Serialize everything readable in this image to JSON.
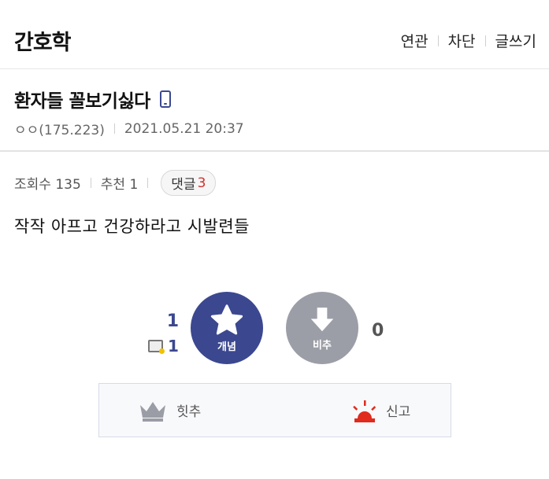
{
  "header": {
    "gallery_title": "간호학",
    "menu": [
      "연관",
      "차단",
      "글쓰기"
    ]
  },
  "post": {
    "title": "환자들 꼴보기싫다",
    "author": "ㅇㅇ(175.223)",
    "date": "2021.05.21 20:37",
    "views_label": "조회수 135",
    "recommend_label": "추천 1",
    "comments_label": "댓글",
    "comments_count": "3",
    "body": "작작 아프고 건강하라고 시발련들"
  },
  "votes": {
    "up_count": "1",
    "fixed_up_count": "1",
    "up_label": "개념",
    "down_label": "비추",
    "down_count": "0"
  },
  "actions": {
    "hit_label": "힛추",
    "report_label": "신고"
  },
  "colors": {
    "accent": "#3b4890",
    "downvote": "#9c9ea7",
    "report": "#e02b1d",
    "comment_count": "#d0312d"
  },
  "icons": [
    "phone-icon",
    "star-icon",
    "arrow-down-icon",
    "mini-vote-icon",
    "crown-icon",
    "siren-icon"
  ]
}
